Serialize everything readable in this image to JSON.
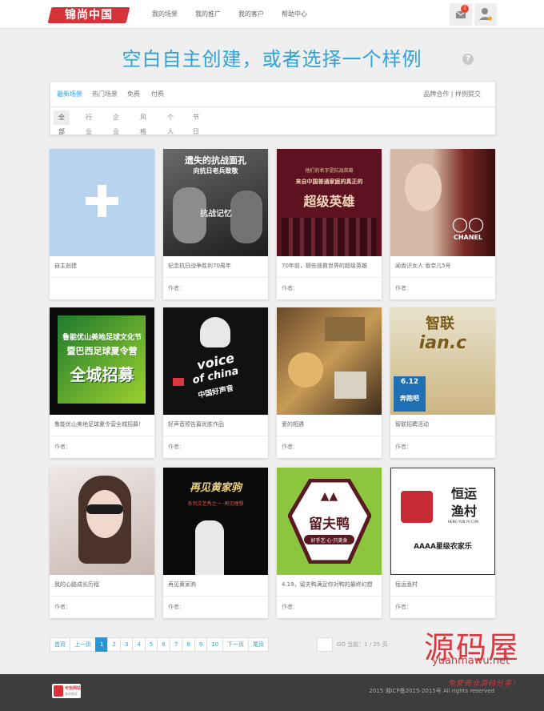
{
  "brand": {
    "logo_text": "锦尚中国",
    "accent": "#2fa2d8",
    "logo_color": "#d6323a"
  },
  "nav": [
    "我的场景",
    "我的推广",
    "我的客户",
    "帮助中心"
  ],
  "topbar": {
    "mail_badge": "1"
  },
  "heading": "空白自主创建，或者选择一个样例",
  "filter": {
    "tabs": [
      "最新场景",
      "热门场景",
      "免费",
      "付费"
    ],
    "right": "品牌合作 | 样例提交",
    "subtabs": [
      "全部",
      "行业",
      "企业",
      "风格",
      "个人",
      "节日"
    ]
  },
  "cards": [
    {
      "title": "自主创建",
      "author": "",
      "thumb": "create"
    },
    {
      "title": "纪念抗日战争胜利70周年",
      "author": "作者：",
      "thumb_lines": [
        "遗失的抗战面孔",
        "向抗日老兵致敬",
        "抗战记忆"
      ]
    },
    {
      "title": "70年前，那些拯救世界的超级英雄",
      "author": "作者：",
      "thumb_lines": [
        "他们的名字是抗战英雄",
        "来自中国普通家庭的真正的",
        "超级英雄"
      ]
    },
    {
      "title": "闻香识女人 香奈儿5号",
      "author": "作者：",
      "thumb_lines": [
        "CHANEL"
      ]
    },
    {
      "title": "鲁能优山美地足球夏令营全城招募！",
      "author": "作者：",
      "thumb_lines": [
        "鲁能优山美地足球文化节",
        "暨巴西足球夏令营",
        "全城招募"
      ]
    },
    {
      "title": "好声音预告篇优胜作品",
      "author": "作者：",
      "thumb_lines": [
        "voice",
        "of china",
        "中国好声音"
      ]
    },
    {
      "title": "爱的相遇",
      "author": "作者：",
      "thumb_lines": []
    },
    {
      "title": "智联招聘活动",
      "author": "作者：",
      "thumb_lines": [
        "智联",
        "6.12",
        "奔跑吧"
      ]
    },
    {
      "title": "我的心路成长历程",
      "author": "作者：",
      "thumb_lines": []
    },
    {
      "title": "再见黄家驹",
      "author": "作者：",
      "thumb_lines": [
        "再见黄家驹",
        "系列文艺秀之一 ·再见理想"
      ]
    },
    {
      "title": "4.19，留夫鸭满足你对鸭的最终幻想",
      "author": "作者：",
      "thumb_lines": [
        "留夫鸭",
        "好手艺·心·只美食"
      ]
    },
    {
      "title": "恒运渔村",
      "author": "作者：",
      "thumb_lines": [
        "恒运",
        "渔村",
        "HENG YUN YU CUN",
        "AAAA星级农家乐"
      ]
    }
  ],
  "pager": {
    "items": [
      "首页",
      "上一页",
      "1",
      "2",
      "3",
      "4",
      "5",
      "6",
      "7",
      "8",
      "9",
      "10",
      "下一页",
      "尾页"
    ],
    "current": "1",
    "go_text": "GO 当前：1 / 25 页"
  },
  "watermark": {
    "line1": "源码屋",
    "line2": "yuanmawu.net",
    "line3": "免费商业源码分享！"
  },
  "footer": {
    "badge_t1": "可信网站",
    "badge_t2": "身份验证",
    "copyright": "2015 湘ICP备2015-2015号 All rights reserved"
  }
}
